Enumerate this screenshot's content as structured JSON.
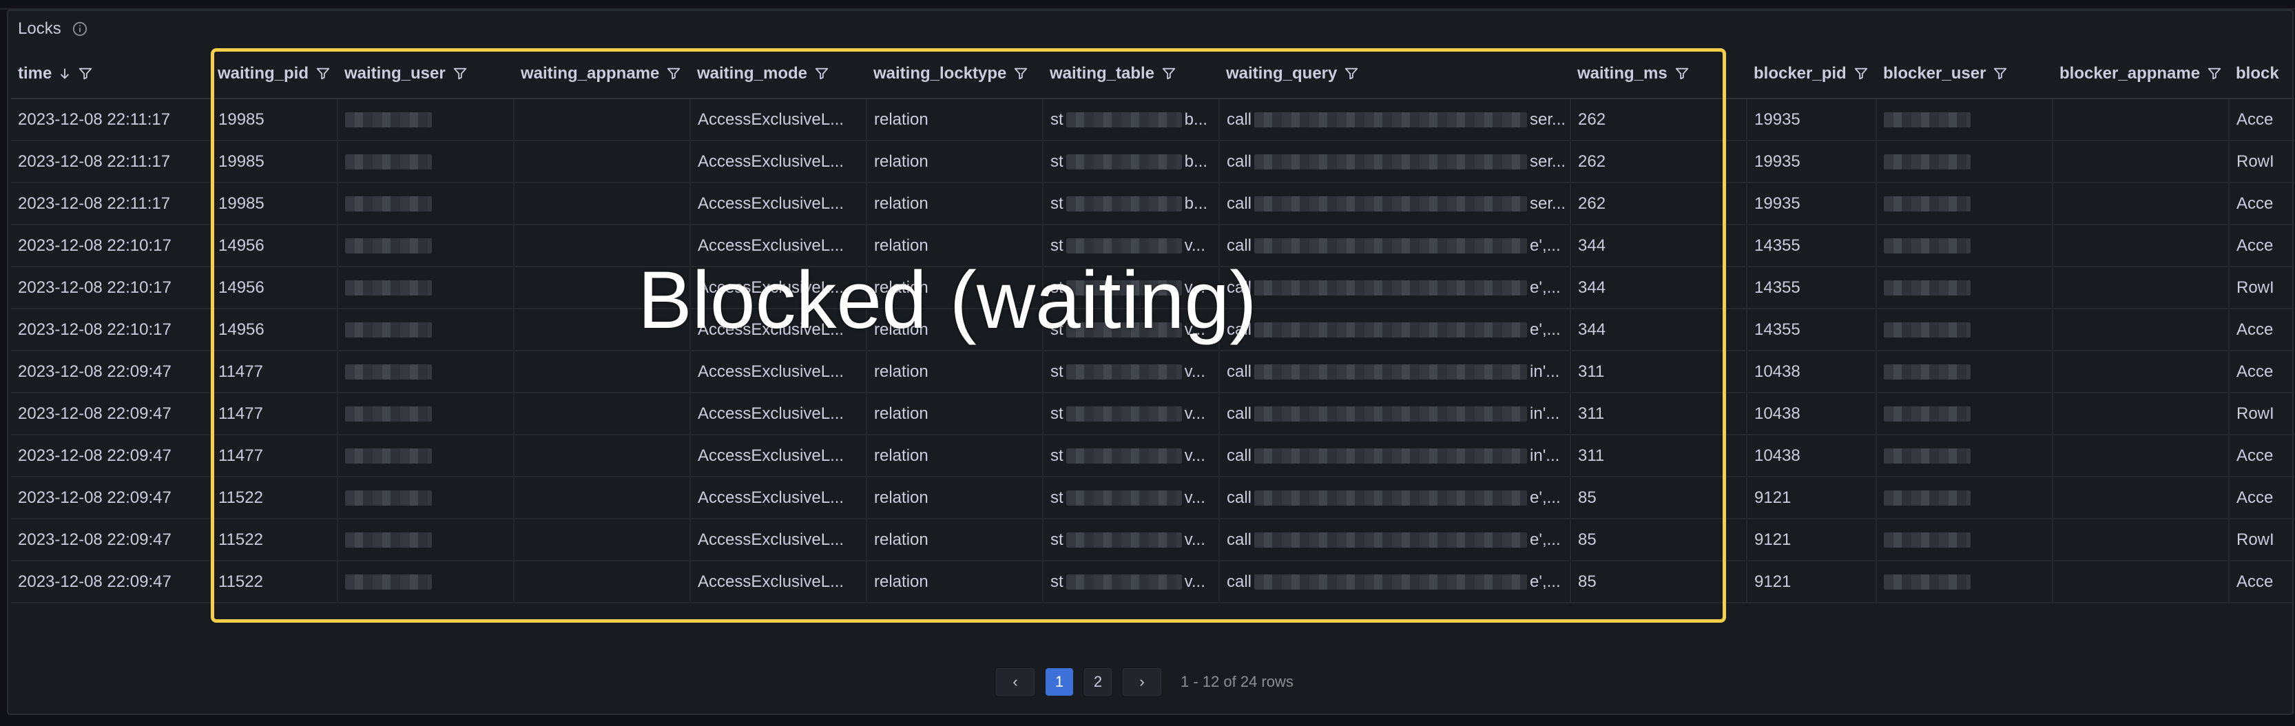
{
  "panel": {
    "title": "Locks"
  },
  "columns": [
    {
      "label": "time",
      "sort": "desc"
    },
    {
      "label": "waiting_pid"
    },
    {
      "label": "waiting_user"
    },
    {
      "label": "waiting_appname"
    },
    {
      "label": "waiting_mode"
    },
    {
      "label": "waiting_locktype"
    },
    {
      "label": "waiting_table"
    },
    {
      "label": "waiting_query"
    },
    {
      "label": "waiting_ms"
    },
    {
      "label": "blocker_pid"
    },
    {
      "label": "blocker_user"
    },
    {
      "label": "blocker_appname"
    },
    {
      "label": "block"
    }
  ],
  "rows": [
    {
      "time": "2023-12-08 22:11:17",
      "waiting_pid": "19985",
      "waiting_mode": "AccessExclusiveL...",
      "waiting_locktype": "relation",
      "table_prefix": "st",
      "table_suffix": "b...",
      "query_prefix": "call",
      "query_suffix": "ser...",
      "waiting_ms": "262",
      "blocker_pid": "19935",
      "blocker_mode": "Acce"
    },
    {
      "time": "2023-12-08 22:11:17",
      "waiting_pid": "19985",
      "waiting_mode": "AccessExclusiveL...",
      "waiting_locktype": "relation",
      "table_prefix": "st",
      "table_suffix": "b...",
      "query_prefix": "call",
      "query_suffix": "ser...",
      "waiting_ms": "262",
      "blocker_pid": "19935",
      "blocker_mode": "RowI"
    },
    {
      "time": "2023-12-08 22:11:17",
      "waiting_pid": "19985",
      "waiting_mode": "AccessExclusiveL...",
      "waiting_locktype": "relation",
      "table_prefix": "st",
      "table_suffix": "b...",
      "query_prefix": "call",
      "query_suffix": "ser...",
      "waiting_ms": "262",
      "blocker_pid": "19935",
      "blocker_mode": "Acce"
    },
    {
      "time": "2023-12-08 22:10:17",
      "waiting_pid": "14956",
      "waiting_mode": "AccessExclusiveL...",
      "waiting_locktype": "relation",
      "table_prefix": "st",
      "table_suffix": "v...",
      "query_prefix": "call",
      "query_suffix": "e',...",
      "waiting_ms": "344",
      "blocker_pid": "14355",
      "blocker_mode": "Acce"
    },
    {
      "time": "2023-12-08 22:10:17",
      "waiting_pid": "14956",
      "waiting_mode": "AccessExclusiveL...",
      "waiting_locktype": "relation",
      "table_prefix": "st",
      "table_suffix": "v...",
      "query_prefix": "call",
      "query_suffix": "e',...",
      "waiting_ms": "344",
      "blocker_pid": "14355",
      "blocker_mode": "RowI"
    },
    {
      "time": "2023-12-08 22:10:17",
      "waiting_pid": "14956",
      "waiting_mode": "AccessExclusiveL...",
      "waiting_locktype": "relation",
      "table_prefix": "st",
      "table_suffix": "v...",
      "query_prefix": "call",
      "query_suffix": "e',...",
      "waiting_ms": "344",
      "blocker_pid": "14355",
      "blocker_mode": "Acce"
    },
    {
      "time": "2023-12-08 22:09:47",
      "waiting_pid": "11477",
      "waiting_mode": "AccessExclusiveL...",
      "waiting_locktype": "relation",
      "table_prefix": "st",
      "table_suffix": "v...",
      "query_prefix": "call",
      "query_suffix": "in'...",
      "waiting_ms": "311",
      "blocker_pid": "10438",
      "blocker_mode": "Acce"
    },
    {
      "time": "2023-12-08 22:09:47",
      "waiting_pid": "11477",
      "waiting_mode": "AccessExclusiveL...",
      "waiting_locktype": "relation",
      "table_prefix": "st",
      "table_suffix": "v...",
      "query_prefix": "call",
      "query_suffix": "in'...",
      "waiting_ms": "311",
      "blocker_pid": "10438",
      "blocker_mode": "RowI"
    },
    {
      "time": "2023-12-08 22:09:47",
      "waiting_pid": "11477",
      "waiting_mode": "AccessExclusiveL...",
      "waiting_locktype": "relation",
      "table_prefix": "st",
      "table_suffix": "v...",
      "query_prefix": "call",
      "query_suffix": "in'...",
      "waiting_ms": "311",
      "blocker_pid": "10438",
      "blocker_mode": "Acce"
    },
    {
      "time": "2023-12-08 22:09:47",
      "waiting_pid": "11522",
      "waiting_mode": "AccessExclusiveL...",
      "waiting_locktype": "relation",
      "table_prefix": "st",
      "table_suffix": "v...",
      "query_prefix": "call",
      "query_suffix": "e',...",
      "waiting_ms": "85",
      "blocker_pid": "9121",
      "blocker_mode": "Acce"
    },
    {
      "time": "2023-12-08 22:09:47",
      "waiting_pid": "11522",
      "waiting_mode": "AccessExclusiveL...",
      "waiting_locktype": "relation",
      "table_prefix": "st",
      "table_suffix": "v...",
      "query_prefix": "call",
      "query_suffix": "e',...",
      "waiting_ms": "85",
      "blocker_pid": "9121",
      "blocker_mode": "RowI"
    },
    {
      "time": "2023-12-08 22:09:47",
      "waiting_pid": "11522",
      "waiting_mode": "AccessExclusiveL...",
      "waiting_locktype": "relation",
      "table_prefix": "st",
      "table_suffix": "v...",
      "query_prefix": "call",
      "query_suffix": "e',...",
      "waiting_ms": "85",
      "blocker_pid": "9121",
      "blocker_mode": "Acce"
    }
  ],
  "annotation": {
    "text": "Blocked (waiting)",
    "highlight_color": "#f5cf4a"
  },
  "pagination": {
    "prev": "‹",
    "next": "›",
    "pages": [
      "1",
      "2"
    ],
    "current": "1",
    "summary": "1 - 12 of 24 rows"
  },
  "colors": {
    "background": "#111217",
    "panel": "#181b1f",
    "accent": "#3d71d9",
    "text": "#ccccdc"
  },
  "icons": {
    "info": "info-icon",
    "filter": "filter-icon",
    "sort": "arrow-down-icon",
    "redacted": "redacted-blur"
  }
}
